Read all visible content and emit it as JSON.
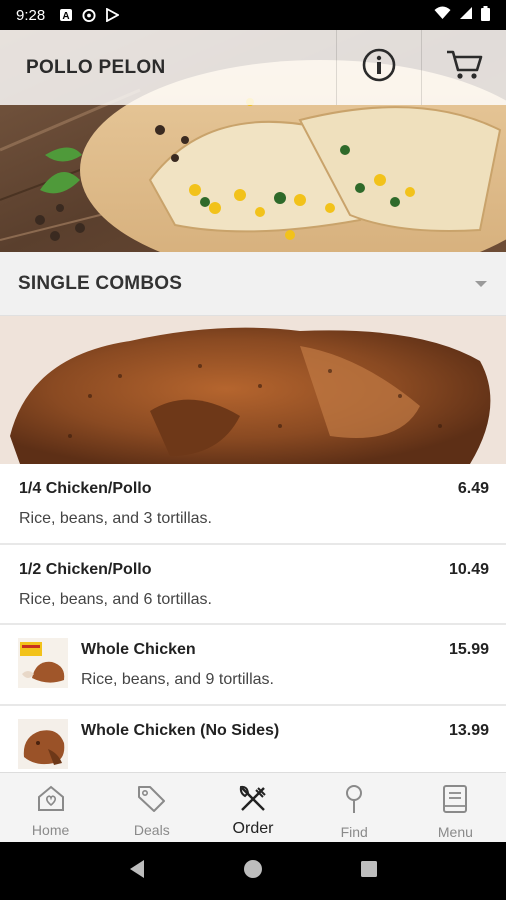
{
  "status_bar": {
    "time": "9:28",
    "icons_left": [
      "a-icon",
      "sync-icon",
      "play-store-icon"
    ],
    "icons_right": [
      "wifi-icon",
      "signal-icon",
      "battery-icon"
    ]
  },
  "app_bar": {
    "title": "POLLO PELON",
    "actions": [
      "info-icon",
      "cart-icon"
    ]
  },
  "category": {
    "selected": "SINGLE COMBOS"
  },
  "menu_items": [
    {
      "name": "1/4 Chicken/Pollo",
      "price": "6.49",
      "description": "Rice, beans, and 3 tortillas.",
      "has_thumb": false
    },
    {
      "name": "1/2 Chicken/Pollo",
      "price": "10.49",
      "description": "Rice, beans, and 6 tortillas.",
      "has_thumb": false
    },
    {
      "name": "Whole Chicken",
      "price": "15.99",
      "description": "Rice, beans, and 9 tortillas.",
      "has_thumb": true
    },
    {
      "name": "Whole Chicken (No Sides)",
      "price": "13.99",
      "description": "",
      "has_thumb": true
    }
  ],
  "bottom_nav": {
    "items": [
      {
        "label": "Home",
        "icon": "home-heart-icon",
        "active": false
      },
      {
        "label": "Deals",
        "icon": "tags-icon",
        "active": false
      },
      {
        "label": "Order",
        "icon": "utensils-icon",
        "active": true
      },
      {
        "label": "Find",
        "icon": "map-pin-icon",
        "active": false
      },
      {
        "label": "Menu",
        "icon": "book-icon",
        "active": false
      }
    ]
  },
  "colors": {
    "status_bar": "#000000",
    "active_nav": "#222222",
    "inactive_nav": "#8a8a8a",
    "category_bg": "#f1f1f1"
  }
}
